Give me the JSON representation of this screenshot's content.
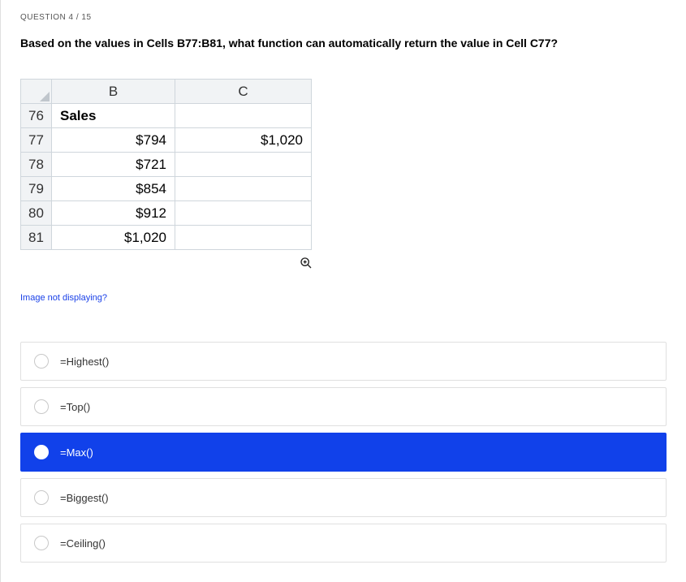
{
  "question_counter": "QUESTION 4 / 15",
  "question_text": "Based on the values in Cells B77:B81, what function can automatically return the value in Cell C77?",
  "spreadsheet": {
    "col_headers": {
      "b": "B",
      "c": "C"
    },
    "rows": {
      "r76": {
        "num": "76",
        "b": "Sales",
        "c": ""
      },
      "r77": {
        "num": "77",
        "b": "$794",
        "c": "$1,020"
      },
      "r78": {
        "num": "78",
        "b": "$721",
        "c": ""
      },
      "r79": {
        "num": "79",
        "b": "$854",
        "c": ""
      },
      "r80": {
        "num": "80",
        "b": "$912",
        "c": ""
      },
      "r81": {
        "num": "81",
        "b": "$1,020",
        "c": ""
      }
    }
  },
  "image_link": "Image not displaying?",
  "options": {
    "a": "=Highest()",
    "b": "=Top()",
    "c": "=Max()",
    "d": "=Biggest()",
    "e": "=Ceiling()"
  },
  "selected_option": "c"
}
